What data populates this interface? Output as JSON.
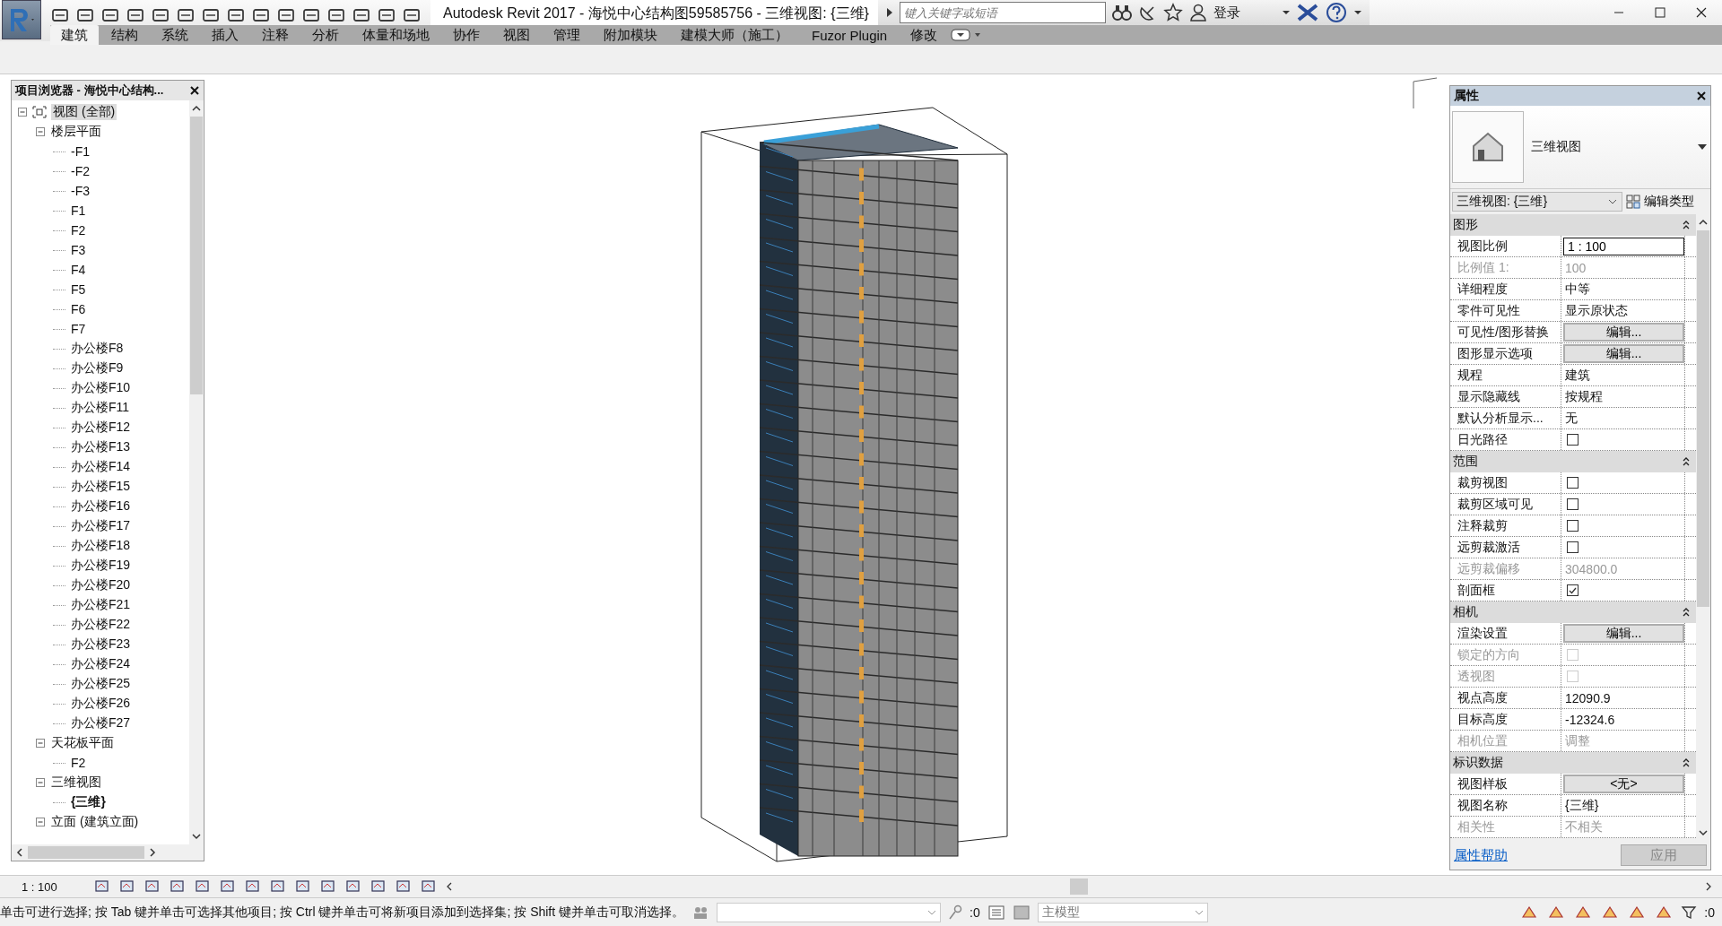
{
  "title_bar": {
    "title": "Autodesk Revit 2017 -    海悦中心结构图59585756 - 三维视图: {三维}",
    "search": {
      "placeholder": "键入关键字或短语"
    },
    "login": "登录"
  },
  "ribbon_tabs": [
    {
      "label": "建筑",
      "selected": true
    },
    {
      "label": "结构",
      "selected": false
    },
    {
      "label": "系统",
      "selected": false
    },
    {
      "label": "插入",
      "selected": false
    },
    {
      "label": "注释",
      "selected": false
    },
    {
      "label": "分析",
      "selected": false
    },
    {
      "label": "体量和场地",
      "selected": false
    },
    {
      "label": "协作",
      "selected": false
    },
    {
      "label": "视图",
      "selected": false
    },
    {
      "label": "管理",
      "selected": false
    },
    {
      "label": "附加模块",
      "selected": false
    },
    {
      "label": "建模大师（施工）",
      "selected": false
    },
    {
      "label": "Fuzor Plugin",
      "selected": false
    },
    {
      "label": "修改",
      "selected": false
    }
  ],
  "project_browser": {
    "title": "项目浏览器 - 海悦中心结构...",
    "tree": [
      {
        "label": "视图 (全部)",
        "selected": true,
        "current": false,
        "expanded": true,
        "children": [
          {
            "label": "楼层平面",
            "selected": false,
            "current": false,
            "expanded": true,
            "children": [
              {
                "label": "-F1",
                "selected": false,
                "current": false
              },
              {
                "label": "-F2",
                "selected": false,
                "current": false
              },
              {
                "label": "-F3",
                "selected": false,
                "current": false
              },
              {
                "label": "F1",
                "selected": false,
                "current": false
              },
              {
                "label": "F2",
                "selected": false,
                "current": false
              },
              {
                "label": "F3",
                "selected": false,
                "current": false
              },
              {
                "label": "F4",
                "selected": false,
                "current": false
              },
              {
                "label": "F5",
                "selected": false,
                "current": false
              },
              {
                "label": "F6",
                "selected": false,
                "current": false
              },
              {
                "label": "F7",
                "selected": false,
                "current": false
              },
              {
                "label": "办公楼F8",
                "selected": false,
                "current": false
              },
              {
                "label": "办公楼F9",
                "selected": false,
                "current": false
              },
              {
                "label": "办公楼F10",
                "selected": false,
                "current": false
              },
              {
                "label": "办公楼F11",
                "selected": false,
                "current": false
              },
              {
                "label": "办公楼F12",
                "selected": false,
                "current": false
              },
              {
                "label": "办公楼F13",
                "selected": false,
                "current": false
              },
              {
                "label": "办公楼F14",
                "selected": false,
                "current": false
              },
              {
                "label": "办公楼F15",
                "selected": false,
                "current": false
              },
              {
                "label": "办公楼F16",
                "selected": false,
                "current": false
              },
              {
                "label": "办公楼F17",
                "selected": false,
                "current": false
              },
              {
                "label": "办公楼F18",
                "selected": false,
                "current": false
              },
              {
                "label": "办公楼F19",
                "selected": false,
                "current": false
              },
              {
                "label": "办公楼F20",
                "selected": false,
                "current": false
              },
              {
                "label": "办公楼F21",
                "selected": false,
                "current": false
              },
              {
                "label": "办公楼F22",
                "selected": false,
                "current": false
              },
              {
                "label": "办公楼F23",
                "selected": false,
                "current": false
              },
              {
                "label": "办公楼F24",
                "selected": false,
                "current": false
              },
              {
                "label": "办公楼F25",
                "selected": false,
                "current": false
              },
              {
                "label": "办公楼F26",
                "selected": false,
                "current": false
              },
              {
                "label": "办公楼F27",
                "selected": false,
                "current": false
              }
            ]
          },
          {
            "label": "天花板平面",
            "selected": false,
            "current": false,
            "expanded": true,
            "children": [
              {
                "label": "F2",
                "selected": false,
                "current": false
              }
            ]
          },
          {
            "label": "三维视图",
            "selected": false,
            "current": false,
            "expanded": true,
            "children": [
              {
                "label": "{三维}",
                "selected": false,
                "current": true
              }
            ]
          },
          {
            "label": "立面 (建筑立面)",
            "selected": false,
            "current": false,
            "expanded": true
          }
        ]
      }
    ]
  },
  "properties": {
    "title": "属性",
    "type_name": "三维视图",
    "instance_selector": "三维视图: {三维}",
    "edit_type": "编辑类型",
    "groups": [
      {
        "name": "图形",
        "rows": [
          {
            "label": "视图比例",
            "kind": "input",
            "value": "1 : 100",
            "disabled": false
          },
          {
            "label": "比例值 1:",
            "kind": "text",
            "value": "100",
            "disabled": true
          },
          {
            "label": "详细程度",
            "kind": "text",
            "value": "中等",
            "disabled": false
          },
          {
            "label": "零件可见性",
            "kind": "text",
            "value": "显示原状态",
            "disabled": false
          },
          {
            "label": "可见性/图形替换",
            "kind": "button",
            "value": "编辑...",
            "disabled": false
          },
          {
            "label": "图形显示选项",
            "kind": "button",
            "value": "编辑...",
            "disabled": false
          },
          {
            "label": "规程",
            "kind": "text",
            "value": "建筑",
            "disabled": false
          },
          {
            "label": "显示隐藏线",
            "kind": "text",
            "value": "按规程",
            "disabled": false
          },
          {
            "label": "默认分析显示...",
            "kind": "text",
            "value": "无",
            "disabled": false
          },
          {
            "label": "日光路径",
            "kind": "checkbox",
            "checked": false,
            "disabled": false
          }
        ]
      },
      {
        "name": "范围",
        "rows": [
          {
            "label": "裁剪视图",
            "kind": "checkbox",
            "checked": false,
            "disabled": false
          },
          {
            "label": "裁剪区域可见",
            "kind": "checkbox",
            "checked": false,
            "disabled": false
          },
          {
            "label": "注释裁剪",
            "kind": "checkbox",
            "checked": false,
            "disabled": false
          },
          {
            "label": "远剪裁激活",
            "kind": "checkbox",
            "checked": false,
            "disabled": false
          },
          {
            "label": "远剪裁偏移",
            "kind": "text",
            "value": "304800.0",
            "disabled": true
          },
          {
            "label": "剖面框",
            "kind": "checkbox",
            "checked": true,
            "disabled": false
          }
        ]
      },
      {
        "name": "相机",
        "rows": [
          {
            "label": "渲染设置",
            "kind": "button",
            "value": "编辑...",
            "disabled": false
          },
          {
            "label": "锁定的方向",
            "kind": "checkbox",
            "checked": false,
            "disabled": true
          },
          {
            "label": "透视图",
            "kind": "checkbox",
            "checked": false,
            "disabled": true
          },
          {
            "label": "视点高度",
            "kind": "text",
            "value": "12090.9",
            "disabled": false
          },
          {
            "label": "目标高度",
            "kind": "text",
            "value": "-12324.6",
            "disabled": false
          },
          {
            "label": "相机位置",
            "kind": "text",
            "value": "调整",
            "disabled": true
          }
        ]
      },
      {
        "name": "标识数据",
        "rows": [
          {
            "label": "视图样板",
            "kind": "button",
            "value": "<无>",
            "disabled": false
          },
          {
            "label": "视图名称",
            "kind": "text",
            "value": "{三维}",
            "disabled": false
          },
          {
            "label": "相关性",
            "kind": "text",
            "value": "不相关",
            "disabled": true
          }
        ]
      }
    ],
    "help_link": "属性帮助",
    "apply_button": {
      "label": "应用",
      "disabled": true
    }
  },
  "view_control_bar": {
    "scale": "1 : 100"
  },
  "status_bar": {
    "message": "单击可进行选择; 按 Tab 键并单击可选择其他项目; 按 Ctrl 键并单击可将新项目添加到选择集; 按 Shift 键并单击可取消选择。",
    "workset_count": ":0",
    "model": "主模型",
    "selection_count": ":0"
  }
}
